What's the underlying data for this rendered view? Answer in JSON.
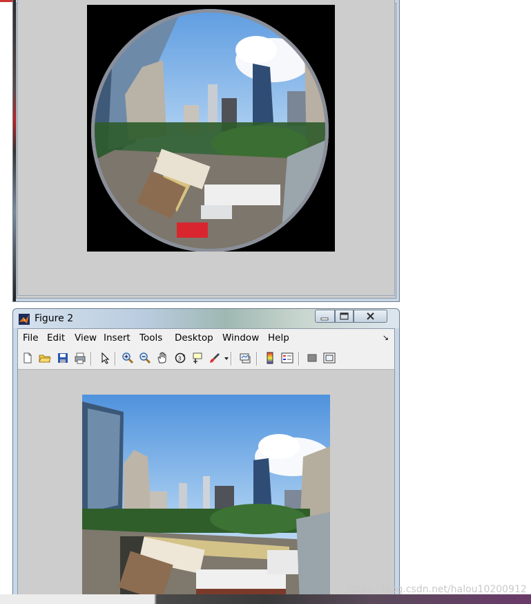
{
  "figure1": {
    "image_alt": ""
  },
  "figure2": {
    "title": "Figure 2",
    "menu": [
      "File",
      "Edit",
      "View",
      "Insert",
      "Tools",
      "Desktop",
      "Window",
      "Help"
    ],
    "menu_overflow": "↘",
    "toolbar_icons": [
      "new-figure-icon",
      "open-file-icon",
      "save-icon",
      "print-icon",
      "select-arrow-icon",
      "zoom-in-icon",
      "zoom-out-icon",
      "pan-hand-icon",
      "rotate-3d-icon",
      "data-cursor-icon",
      "brush-icon",
      "brush-dropdown-icon",
      "link-plot-icon",
      "colorbar-icon",
      "legend-icon",
      "hide-plot-tools-icon",
      "show-plot-tools-icon"
    ]
  },
  "watermark": "https://blog.csdn.net/halou10200912"
}
